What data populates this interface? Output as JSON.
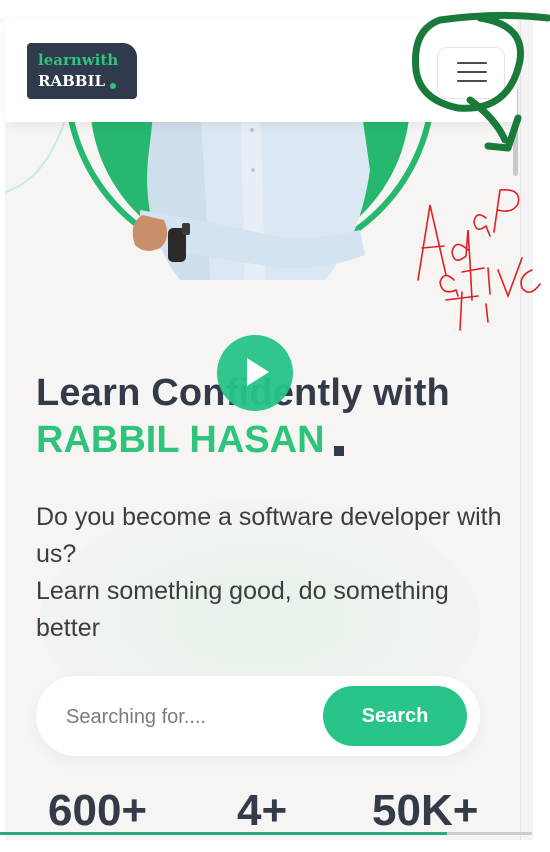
{
  "logo": {
    "line1": "learnwith",
    "line2": "RABBIL",
    "accent": "#2ec47b",
    "bg": "#303a4d"
  },
  "header": {
    "menu_icon": "hamburger-menu-icon"
  },
  "hero": {
    "play_icon": "play-icon",
    "headline": "Learn Confidently with",
    "name": "RABBIL HASAN",
    "description_line1": "Do you become a software developer with us?",
    "description_line2": "Learn something good, do something better"
  },
  "search": {
    "placeholder": "Searching for....",
    "value": "",
    "button_label": "Search"
  },
  "stats": [
    {
      "value": "600+"
    },
    {
      "value": "4+"
    },
    {
      "value": "50K+"
    }
  ],
  "annotation": {
    "handwritten_text": "Adaptive"
  },
  "colors": {
    "primary_green": "#28c48a",
    "heading_dark": "#333a48",
    "background": "#f6f5f3",
    "annotation_green": "#1a7a3a",
    "annotation_red": "#e02020"
  }
}
